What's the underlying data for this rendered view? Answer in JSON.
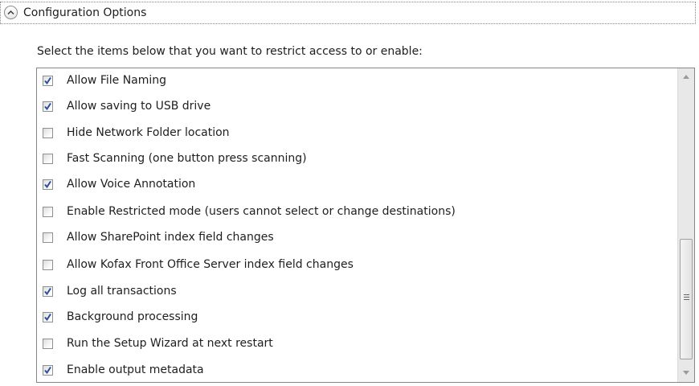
{
  "section": {
    "title": "Configuration Options",
    "toggle_icon": "chevron-up-icon"
  },
  "instruction": "Select the items below that you want to restrict access to or enable:",
  "options": [
    {
      "label": "Allow File Naming",
      "checked": true
    },
    {
      "label": "Allow saving to USB drive",
      "checked": true
    },
    {
      "label": "Hide Network Folder location",
      "checked": false
    },
    {
      "label": "Fast Scanning (one button press scanning)",
      "checked": false
    },
    {
      "label": "Allow Voice Annotation",
      "checked": true
    },
    {
      "label": "Enable Restricted mode (users cannot select or change destinations)",
      "checked": false
    },
    {
      "label": "Allow SharePoint index field changes",
      "checked": false
    },
    {
      "label": "Allow Kofax Front Office Server index field changes",
      "checked": false
    },
    {
      "label": "Log all transactions",
      "checked": true
    },
    {
      "label": "Background processing",
      "checked": true
    },
    {
      "label": "Run the Setup Wizard at next restart",
      "checked": false
    },
    {
      "label": "Enable output metadata",
      "checked": true
    }
  ],
  "scrollbar": {
    "up_icon": "scroll-up-arrow-icon",
    "down_icon": "scroll-down-arrow-icon",
    "thumb_icon": "scroll-grip-icon",
    "scroll_position": 0.85
  },
  "colors": {
    "check_mark": "#2b4c9b",
    "border": "#828790"
  }
}
